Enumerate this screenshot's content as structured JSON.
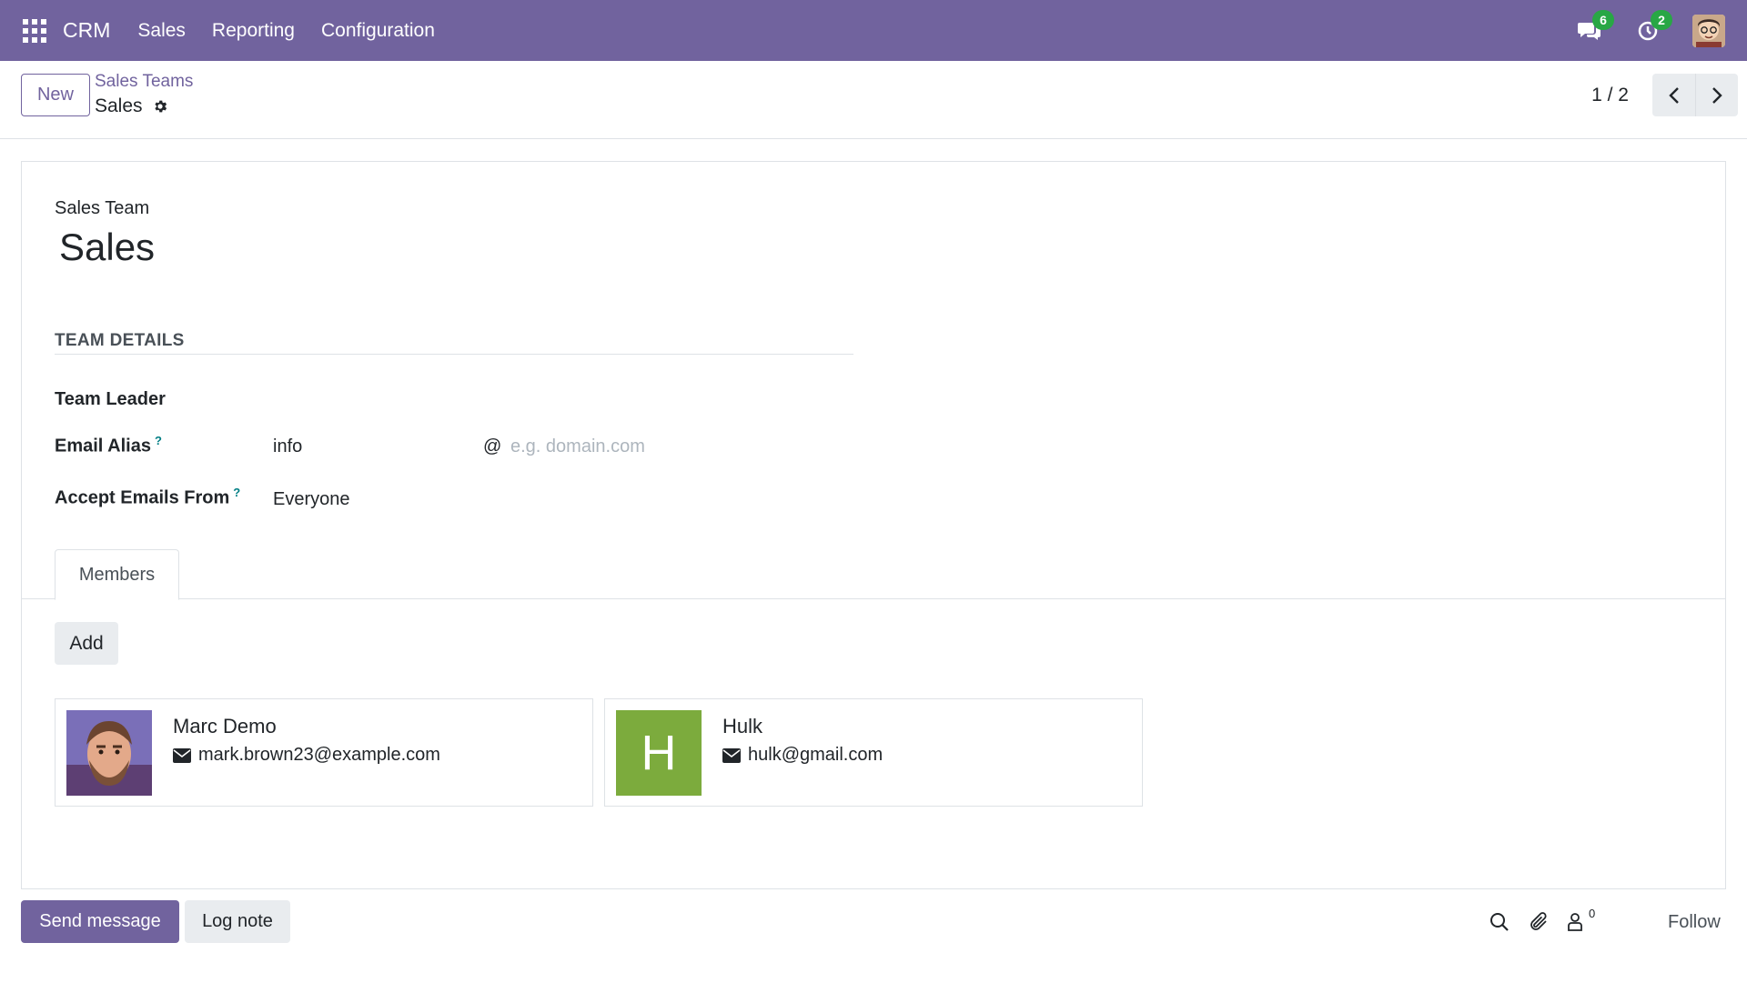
{
  "navbar": {
    "brand": "CRM",
    "menu": [
      "Sales",
      "Reporting",
      "Configuration"
    ],
    "messages_count": "6",
    "activities_count": "2"
  },
  "control": {
    "new_label": "New",
    "breadcrumb_parent": "Sales Teams",
    "breadcrumb_current": "Sales",
    "pager": "1 / 2"
  },
  "form": {
    "name_label": "Sales Team",
    "name": "Sales",
    "section_title": "TEAM DETAILS",
    "team_leader_label": "Team Leader",
    "email_alias_label": "Email Alias",
    "email_alias_help": "?",
    "email_alias_value": "info",
    "email_at": "@",
    "email_domain_placeholder": "e.g. domain.com",
    "accept_emails_label": "Accept Emails From",
    "accept_emails_help": "?",
    "accept_emails_value": "Everyone",
    "tab_members": "Members",
    "add_label": "Add",
    "members": [
      {
        "name": "Marc Demo",
        "email": "mark.brown23@example.com"
      },
      {
        "name": "Hulk",
        "email": "hulk@gmail.com",
        "initial": "H"
      }
    ]
  },
  "chatter": {
    "send_message": "Send message",
    "log_note": "Log note",
    "followers_count": "0",
    "follow": "Follow"
  },
  "colors": {
    "brand": "#71639e",
    "badge": "#28a745",
    "avatar_h": "#7cab3d"
  }
}
